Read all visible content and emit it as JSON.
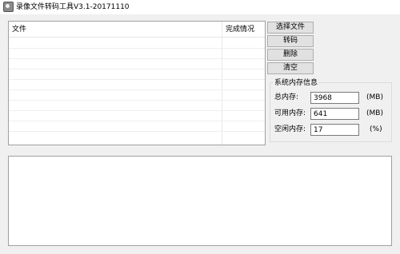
{
  "window": {
    "title": "录像文件转码工具V3.1-20171110",
    "icon": "app-video-icon"
  },
  "file_list": {
    "columns": [
      "文件",
      "完成情况"
    ],
    "rows": []
  },
  "buttons": {
    "select_file": "选择文件",
    "transcode": "转码",
    "delete": "删除",
    "clear": "清空"
  },
  "memory": {
    "group_title": "系统内存信息",
    "total": {
      "label": "总内存:",
      "value": "3968",
      "unit": "(MB)"
    },
    "available": {
      "label": "可用内存:",
      "value": "641",
      "unit": "(MB)"
    },
    "idle": {
      "label": "空闲内存:",
      "value": "17",
      "unit": "(%)"
    }
  },
  "log": {
    "text": ""
  }
}
